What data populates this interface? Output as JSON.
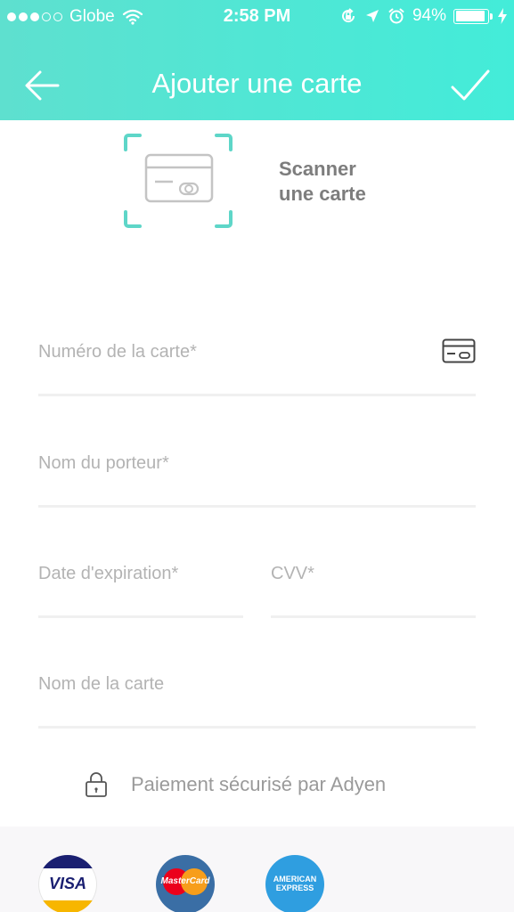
{
  "status_bar": {
    "carrier": "Globe",
    "time": "2:58 PM",
    "battery": "94%",
    "battery_level": 0.94,
    "signal_bars": 3,
    "signal_total": 5
  },
  "nav": {
    "title": "Ajouter une carte",
    "back_icon": "arrow-left-icon",
    "confirm_icon": "checkmark-icon"
  },
  "scan": {
    "label_line1": "Scanner",
    "label_line2": "une carte",
    "icon": "card-scan-icon"
  },
  "form": {
    "card_number_placeholder": "Numéro de la carte*",
    "card_number_value": "",
    "holder_placeholder": "Nom du porteur*",
    "holder_value": "",
    "expiry_placeholder": "Date d'expiration*",
    "expiry_value": "",
    "cvv_placeholder": "CVV*",
    "cvv_value": "",
    "card_name_placeholder": "Nom de la carte",
    "card_name_value": ""
  },
  "secure": {
    "text": "Paiement sécurisé par Adyen",
    "icon": "lock-icon"
  },
  "card_brands": {
    "visa": "VISA",
    "mastercard": "MasterCard",
    "amex_line1": "AMERICAN",
    "amex_line2": "EXPRESS"
  },
  "colors": {
    "header_start": "#5ee0cf",
    "header_end": "#43ecd9",
    "scan_accent": "#5ed6c8",
    "placeholder": "#b3b3b3"
  }
}
